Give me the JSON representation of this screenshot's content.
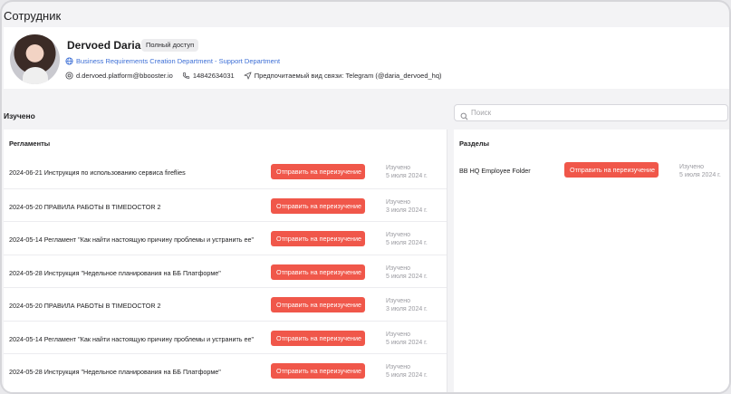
{
  "page": {
    "title": "Сотрудник"
  },
  "profile": {
    "name": "Dervoed Daria",
    "access_badge": "Полный доступ",
    "department": "Business Requirements Creation Department - Support Department",
    "email": "d.dervoed.platform@bbooster.io",
    "phone": "14842634031",
    "preferred_contact": "Предпочитаемый вид связи: Telegram (@daria_dervoed_hq)"
  },
  "studied": {
    "label": "Изучено"
  },
  "search": {
    "placeholder": "Поиск"
  },
  "regulations": {
    "header": "Регламенты",
    "rows": [
      {
        "title": "2024-06-21 Инструкция по использованию сервиса fireflies",
        "action": "Отправить на переизучение",
        "status": "Изучено",
        "date": "5 июля 2024 г."
      },
      {
        "title": "2024-05-20 ПРАВИЛА РАБОТЫ В TIMEDOCTOR 2",
        "action": "Отправить на переизучение",
        "status": "Изучено",
        "date": "3 июля 2024 г."
      },
      {
        "title": "2024-05-14 Регламент \"Как найти настоящую причину проблемы и устранить ее\"",
        "action": "Отправить на переизучение",
        "status": "Изучено",
        "date": "5 июля 2024 г."
      },
      {
        "title": "2024-05-28 Инструкция \"Недельное планирования на ББ Платформе\"",
        "action": "Отправить на переизучение",
        "status": "Изучено",
        "date": "5 июля 2024 г."
      },
      {
        "title": "2024-05-20 ПРАВИЛА РАБОТЫ В TIMEDOCTOR 2",
        "action": "Отправить на переизучение",
        "status": "Изучено",
        "date": "3 июля 2024 г."
      },
      {
        "title": "2024-05-14 Регламент \"Как найти настоящую причину проблемы и устранить ее\"",
        "action": "Отправить на переизучение",
        "status": "Изучено",
        "date": "5 июля 2024 г."
      },
      {
        "title": "2024-05-28 Инструкция \"Недельное планирования на ББ Платформе\"",
        "action": "Отправить на переизучение",
        "status": "Изучено",
        "date": "5 июля 2024 г."
      }
    ]
  },
  "sections": {
    "header": "Разделы",
    "rows": [
      {
        "title": "BB HQ Employee Folder",
        "action": "Отправить на переизучение",
        "status": "Изучено",
        "date": "5 июля 2024 г."
      }
    ]
  },
  "icons": {
    "department": "globe-icon",
    "email": "at-icon",
    "phone": "phone-icon",
    "contact": "send-icon",
    "search": "search-icon"
  },
  "colors": {
    "accent": "#f0574a",
    "link": "#3d6fd6",
    "muted": "#9a9aa0"
  }
}
